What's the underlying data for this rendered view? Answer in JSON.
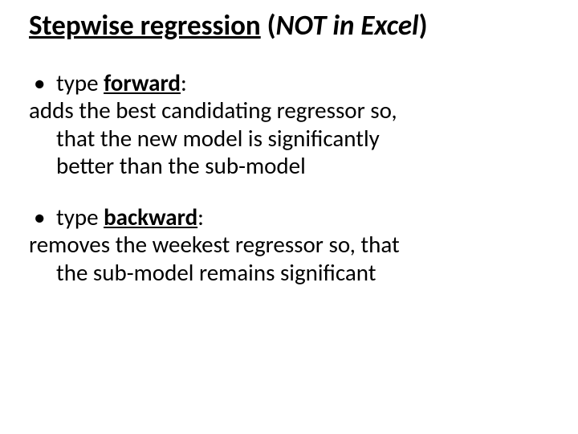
{
  "title": {
    "part1": "Stepwise regression",
    "part2": " (",
    "part3": "NOT in Excel",
    "part4": ")"
  },
  "block1": {
    "bullet_prefix": "type ",
    "bullet_keyword": "forward",
    "bullet_suffix": ":",
    "line1": "adds the best candidating regressor so,",
    "line2": "that the new model is  significantly",
    "line3": "better than the sub-model"
  },
  "block2": {
    "bullet_prefix": "type ",
    "bullet_keyword": "backward",
    "bullet_suffix": ":",
    "line1": "removes the weekest regressor so, that",
    "line2": "the sub-model remains significant"
  },
  "bullet_char": "•"
}
